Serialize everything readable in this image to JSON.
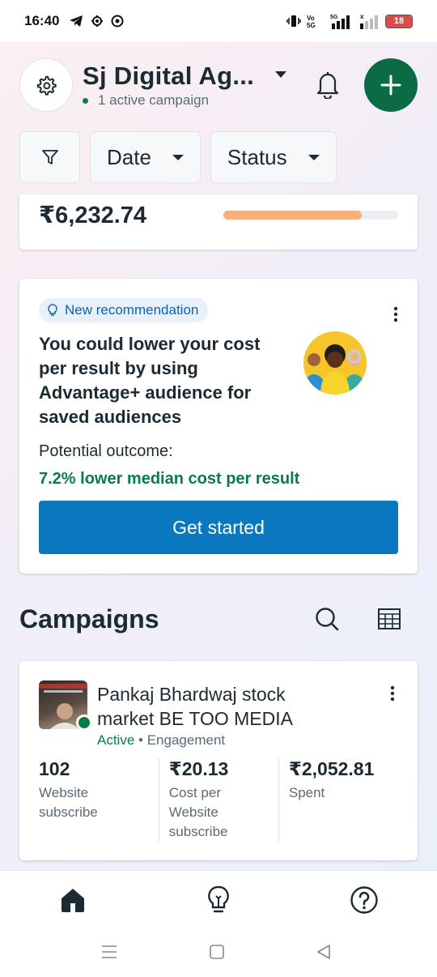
{
  "status_bar": {
    "time": "16:40",
    "battery": "18",
    "battery_level": 0.18,
    "network": "5G"
  },
  "header": {
    "account_name": "Sj Digital Ag...",
    "campaign_summary": "1 active campaign"
  },
  "filters": {
    "date_label": "Date",
    "status_label": "Status"
  },
  "spend": {
    "amount": "₹6,232.74",
    "progress": 0.79
  },
  "recommendation": {
    "badge": "New recommendation",
    "title": "You could lower your cost per result by using Advantage+ audience for saved audiences",
    "outcome_label": "Potential outcome:",
    "outcome_value": "7.2% lower median cost per result",
    "cta_label": "Get started"
  },
  "campaigns": {
    "heading": "Campaigns",
    "items": [
      {
        "name": "Pankaj Bhardwaj stock market BE TOO MEDIA",
        "status": "Active",
        "separator": "•",
        "objective": "Engagement",
        "metrics": [
          {
            "value": "102",
            "label": "Website subscribe"
          },
          {
            "value": "₹20.13",
            "label": "Cost per Website subscribe"
          },
          {
            "value": "₹2,052.81",
            "label": "Spent"
          }
        ]
      }
    ]
  },
  "colors": {
    "brand_green": "#0a6b44",
    "primary_blue": "#0a78be",
    "active_green": "#0a7c4a",
    "progress_orange": "#f6b27a"
  },
  "icons": {
    "settings": "gear-icon",
    "notifications": "bell-icon",
    "create": "plus-icon",
    "filter": "filter-funnel-icon",
    "search": "search-icon",
    "table": "table-grid-icon",
    "home": "home-icon",
    "insights": "lightbulb-icon",
    "help": "help-icon"
  }
}
